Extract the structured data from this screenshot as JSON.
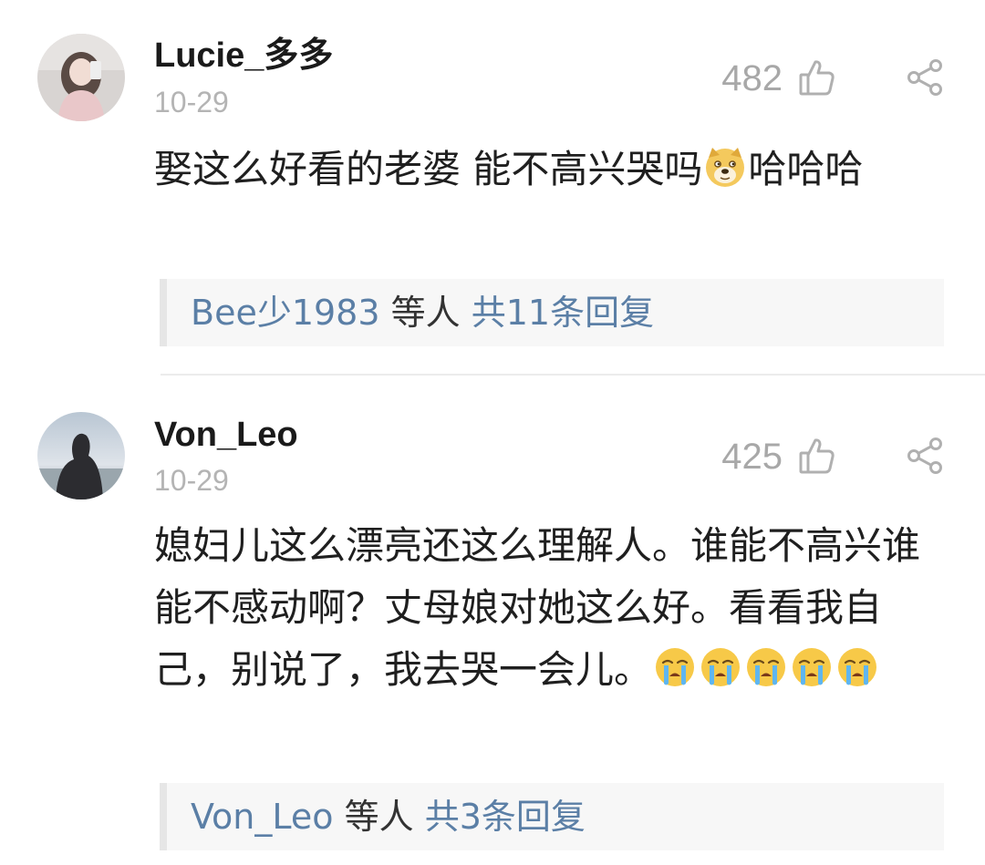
{
  "comments": [
    {
      "username": "Lucie_多多",
      "date": "10-29",
      "likes": "482",
      "text_before_emoji": "娶这么好看的老婆 能不高兴哭吗",
      "emoji": "doge-emoji",
      "text_after_emoji": "哈哈哈",
      "replies": {
        "who": "Bee少1983",
        "middle": " 等人 ",
        "total": "共11条回复"
      }
    },
    {
      "username": "Von_Leo",
      "date": "10-29",
      "likes": "425",
      "text": "媳妇儿这么漂亮还这么理解人。谁能不高兴谁能不感动啊？丈母娘对她这么好。看看我自己，别说了，我去哭一会儿。",
      "emoji": "crying-emoji",
      "emoji_count": 5,
      "replies": {
        "who": "Von_Leo",
        "middle": " 等人 ",
        "total": "共3条回复"
      }
    }
  ],
  "icons": {
    "like": "thumbs-up-icon",
    "share": "share-icon"
  },
  "colors": {
    "username": "#1a1a1a",
    "meta_gray": "#b4b4b4",
    "link_blue": "#5b7fa6",
    "reply_bg": "#f7f7f7"
  }
}
